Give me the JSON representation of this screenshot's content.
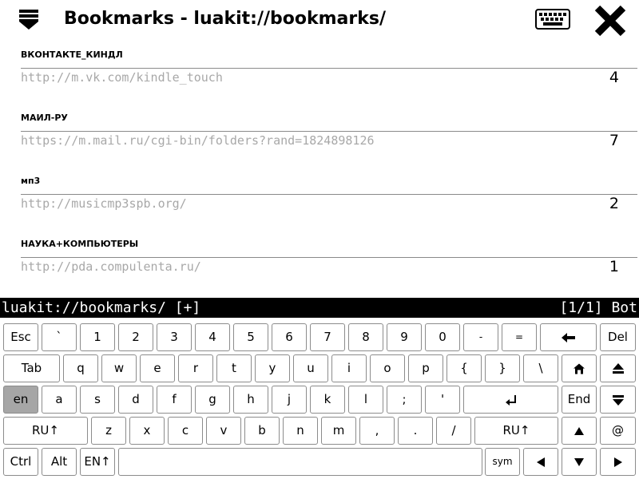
{
  "titlebar": {
    "title": "Bookmarks - luakit://bookmarks/",
    "menu_icon": "menu-icon",
    "keyboard_icon": "keyboard-icon",
    "close_icon": "close-icon"
  },
  "bookmarks": [
    {
      "name": "ВКОНТАКТЕ_КИНДЛ",
      "url": "http://m.vk.com/kindle_touch",
      "count": "4"
    },
    {
      "name": "МАИЛ-РУ",
      "url": "https://m.mail.ru/cgi-bin/folders?rand=1824898126",
      "count": "7"
    },
    {
      "name": "мп3",
      "url": "http://musicmp3spb.org/",
      "count": "2"
    },
    {
      "name": "НАУКА+КОМПЬЮТЕРЫ",
      "url": "http://pda.compulenta.ru/",
      "count": "1"
    }
  ],
  "statusbar": {
    "uri": "luakit://bookmarks/ [+]",
    "position": "[1/1] Bot"
  },
  "keyboard": {
    "row1": [
      "Esc",
      "`",
      "1",
      "2",
      "3",
      "4",
      "5",
      "6",
      "7",
      "8",
      "9",
      "0",
      "-",
      "=",
      "backspace-icon",
      "Del"
    ],
    "row2": [
      "Tab",
      "q",
      "w",
      "e",
      "r",
      "t",
      "y",
      "u",
      "i",
      "o",
      "p",
      "{",
      "}",
      "\\",
      "home-icon",
      "page-up-icon"
    ],
    "row3": [
      "en",
      "a",
      "s",
      "d",
      "f",
      "g",
      "h",
      "j",
      "k",
      "l",
      ";",
      "'",
      "enter-icon",
      "End",
      "page-down-icon"
    ],
    "row4": [
      "RU↑",
      "z",
      "x",
      "c",
      "v",
      "b",
      "n",
      "m",
      ",",
      ".",
      "/",
      "RU↑",
      "up-arrow-icon",
      "@"
    ],
    "row5": [
      "Ctrl",
      "Alt",
      "EN↑",
      "space",
      "sym",
      "left-arrow-icon",
      "down-arrow-icon",
      "right-arrow-icon"
    ],
    "active_key": "en",
    "colors": {
      "active_key": "#a6a6a6",
      "statusbar_bg": "#000000",
      "url_text": "#a8a8a8"
    }
  }
}
